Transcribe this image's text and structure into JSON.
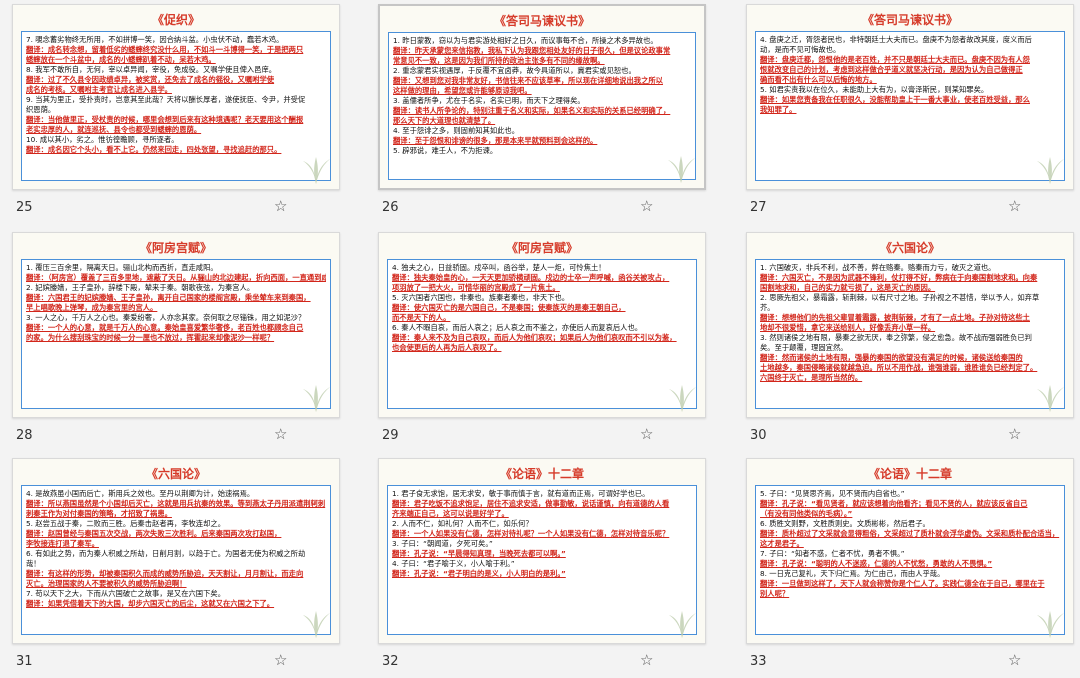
{
  "slides": [
    {
      "number": "25",
      "title": "《促织》",
      "lines": [
        {
          "t": "7. 覗念蓄劣物终无所用，不如拼博一笑，因合纳斗盆。小虫伏不动，蠢若木鸡。",
          "trans": false
        },
        {
          "t": "翻译：成名转念想，留着低劣的蟋蟀终究没什么用，不如斗一斗博得一笑，于是把两只",
          "trans": true
        },
        {
          "t": "蟋蟀放在一个斗盆中，成名的小蟋蟀趴着不动，呆若木鸡。",
          "trans": true
        },
        {
          "t": "8. 我军不敢所自，无何，宰以卓异闻，宰役，免成役。又嘱学使且俾入邑庠。",
          "trans": false
        },
        {
          "t": "翻译：过了不久县令因政绩卓异，被奖赏，还免去了成名的徭役，又嘱咐学使",
          "trans": true
        },
        {
          "t": "成名的考核。又嘱咐主考官让成名进入县学。",
          "trans": true
        },
        {
          "t": "9. 当其为里正，受扑责时，岂意其至此哉？天将以酬长厚者，遂使抚臣、令尹，并受促",
          "trans": false
        },
        {
          "t": "织恩荫。",
          "trans": false
        },
        {
          "t": "翻译：当他做里正，受杖责的时候，哪里会想到后来有这种境遇呢？老天要用这个酬报",
          "trans": true
        },
        {
          "t": "老实忠厚的人，就连巡抚、县令也都受到蟋蟀的恩荫。",
          "trans": true
        },
        {
          "t": "10. 成以其小，劣之。惟彷徨瞻顾，寻所逐者。",
          "trans": false
        },
        {
          "t": "翻译：成名因它个头小，看不上它。仍然来回走，四处张望，寻找追赶的那只。",
          "trans": true
        }
      ]
    },
    {
      "number": "26",
      "title": "《答司马谏议书》",
      "lines": [
        {
          "t": "1. 昨日蒙教，窃以为与君实游处相好之日久，而议事每不合，所操之术多异故也。",
          "trans": false
        },
        {
          "t": "翻译：昨天承蒙您来信指教，我私下认为我跟您相处友好的日子很久，但是议论政事常",
          "trans": true
        },
        {
          "t": "常意见不一致，这是因为我们所持的政治主张多有不同的缘故啊。",
          "trans": true
        },
        {
          "t": "2. 重念蒙君实视遇厚，于反覆不宜卤莽，故今具道所以，冀君实或见恕也。",
          "trans": false
        },
        {
          "t": "翻译：又想到您对我非常友好，书信往来不应该草率，所以现在详细地说出我之所以",
          "trans": true
        },
        {
          "t": "这样做的理由，希望您或许能够原谅我吧。",
          "trans": true
        },
        {
          "t": "3. 盖儒者所争，尤在于名实，名实已明，而天下之理得矣。",
          "trans": false
        },
        {
          "t": "翻译：读书人所争论的，特别注重于名义和实际，如果名义和实际的关系已经明确了，",
          "trans": true
        },
        {
          "t": "那么天下的大道理也就清楚了。",
          "trans": true
        },
        {
          "t": "4. 至于怨诽之多，则固前知其如此也。",
          "trans": false
        },
        {
          "t": "翻译：至于怨恨和诽谤的很多，那是本来早就预料到会这样的。",
          "trans": true
        },
        {
          "t": "5. 辟邪说，难壬人，不为拒谏。",
          "trans": false
        }
      ]
    },
    {
      "number": "27",
      "title": "《答司马谏议书》",
      "lines": [
        {
          "t": "4. 盘庚之迁，胥怨者民也，非特朝廷士大夫而已。盘庚不为怨者故改其度，度义而后",
          "trans": false
        },
        {
          "t": "动，是而不见可悔故也。",
          "trans": false
        },
        {
          "t": "翻译：盘庚迁都，怨恨他的是老百姓，并不只是朝廷士大夫而已。盘庚不因为有人怨",
          "trans": true
        },
        {
          "t": "恨就改变自己的计划，考虑到这样做合乎道义就坚决行动，是因为认为自己做得正",
          "trans": true
        },
        {
          "t": "确而看不出有什么可以后悔的地方。",
          "trans": true
        },
        {
          "t": "5. 如君实责我以在位久，未能助上大有为，以膏泽斯民，则某知罪矣。",
          "trans": false
        },
        {
          "t": "翻译：如果您责备我在任职很久，没能帮助皇上干一番大事业，使老百姓受益，那么",
          "trans": true
        },
        {
          "t": "我知罪了。",
          "trans": true
        }
      ]
    },
    {
      "number": "28",
      "title": "《阿房宫赋》",
      "lines": [
        {
          "t": "1. 覆压三百余里，隔离天日。骊山北构而西折，直走咸阳。",
          "trans": false
        },
        {
          "t": "翻译：（阿房宫）覆盖了三百多里地，遮蔽了天日。从骊山的北边建起，折向西面，一直通到咸阳。",
          "trans": true
        },
        {
          "t": "2. 妃嫔媵嫱，王子皇孙，辞楼下殿，辇来于秦。朝歌夜弦，为秦宫人。",
          "trans": false
        },
        {
          "t": "翻译：六国君王的妃嫔媵嫱、王子皇孙，离开自己国家的楼阁宫殿，乘坐辇车来到秦国，",
          "trans": true
        },
        {
          "t": "早上唱歌晚上弹琴，成为秦宫里的宫人。",
          "trans": true
        },
        {
          "t": "3. 一人之心，千万人之心也。秦爱纷奢，人亦念其家。奈何取之尽锱铢，用之如泥沙？",
          "trans": false
        },
        {
          "t": "翻译：一个人的心意，就是千万人的心意。秦始皇喜爱繁华奢侈，老百姓也都顾念自己",
          "trans": true
        },
        {
          "t": "的家。为什么搜刮珠宝的时候一分一厘也不放过，挥霍起来却像泥沙一样呢？",
          "trans": true
        }
      ]
    },
    {
      "number": "29",
      "title": "《阿房宫赋》",
      "lines": [
        {
          "t": "4. 独夫之心，日益骄固。戍卒叫，函谷举，楚人一炬，可怜焦土！",
          "trans": false
        },
        {
          "t": "翻译：独夫秦始皇的心，一天天更加骄横顽固。戍边的士卒一声呼喊，函谷关被攻占，",
          "trans": true
        },
        {
          "t": "项羽放了一把大火，可惜华丽的宫殿成了一片焦土。",
          "trans": true
        },
        {
          "t": "5. 灭六国者六国也，非秦也。族秦者秦也，非天下也。",
          "trans": false
        },
        {
          "t": "翻译：使六国灭亡的是六国自己，不是秦国；使秦族灭的是秦王朝自己，",
          "trans": true
        },
        {
          "t": "而不是天下的人。",
          "trans": true
        },
        {
          "t": "6. 秦人不暇自哀，而后人哀之；后人哀之而不鉴之，亦使后人而复哀后人也。",
          "trans": false
        },
        {
          "t": "翻译：秦人来不及为自己哀叹，而后人为他们哀叹；如果后人为他们哀叹而不引以为鉴，",
          "trans": true
        },
        {
          "t": "也会使更后的人再为后人哀叹了。",
          "trans": true
        }
      ]
    },
    {
      "number": "30",
      "title": "《六国论》",
      "lines": [
        {
          "t": "1. 六国破灭，非兵不利，战不善，弊在赂秦。赂秦而力亏，破灭之道也。",
          "trans": false
        },
        {
          "t": "翻译：六国灭亡，不是因为武器不锋利，仗打得不好，弊病在于向秦国割地求和。向秦",
          "trans": true
        },
        {
          "t": "国割地求和，自己的实力就亏损了，这是灭亡的原因。",
          "trans": true
        },
        {
          "t": "2. 思厥先祖父，暴霜露，斩荆棘，以有尺寸之地。子孙视之不甚惜，举以予人，如弃草",
          "trans": false
        },
        {
          "t": "芥。",
          "trans": false
        },
        {
          "t": "翻译：想想他们的先祖父辈冒着霜露，披荆斩棘，才有了一点土地。子孙对待这些土",
          "trans": true
        },
        {
          "t": "地却不很爱惜，拿它来送给别人，好像丢弃小草一样。",
          "trans": true
        },
        {
          "t": "3. 然则诸侯之地有限，暴秦之欲无厌，奉之弥繁，侵之愈急。故不战而强弱胜负已判",
          "trans": false
        },
        {
          "t": "矣。至于颠覆，理固宜然。",
          "trans": false
        },
        {
          "t": "翻译：然而诸侯的土地有限，强暴的秦国的欲望没有满足的时候，诸侯送给秦国的",
          "trans": true
        },
        {
          "t": "土地越多，秦国侵略诸侯就越急迫。所以不用作战，谁强谁弱，谁胜谁负已经判定了。",
          "trans": true
        },
        {
          "t": "六国终于灭亡，是理所当然的。",
          "trans": true
        }
      ]
    },
    {
      "number": "31",
      "title": "《六国论》",
      "lines": [
        {
          "t": "4. 是故燕虽小国而后亡，斯用兵之效也。至丹以荆卿为计，始速祸焉。",
          "trans": false
        },
        {
          "t": "翻译：所以燕国虽然是个小国却后灭亡，这就是用兵抗秦的效果。等到燕太子丹用派遣荆轲刺",
          "trans": true
        },
        {
          "t": "刺秦王作为对付秦国的策略，才招致了祸患。",
          "trans": true
        },
        {
          "t": "5. 赵尝五战于秦，二败而三胜。后秦击赵者再，李牧连却之。",
          "trans": false
        },
        {
          "t": "翻译：赵国曾经与秦国五次交战，两次失败三次胜利。后来秦国两次攻打赵国，",
          "trans": true
        },
        {
          "t": "李牧接连打退了秦军。",
          "trans": true
        },
        {
          "t": "6. 有如此之势，而为秦人积威之所劫，日削月割，以趋于亡。为国者无使为积威之所劫",
          "trans": false
        },
        {
          "t": "哉！",
          "trans": false
        },
        {
          "t": "翻译：有这样的形势，却被秦国积久而成的威势所胁迫，天天割让，月月割让，而走向",
          "trans": true
        },
        {
          "t": "灭亡。治理国家的人不要被积久的威势所胁迫啊！",
          "trans": true
        },
        {
          "t": "7. 苟以天下之大，下而从六国破亡之故事，是又在六国下矣。",
          "trans": false
        },
        {
          "t": "翻译：如果凭借着天下的大国，却步六国灭亡的后尘，这就又在六国之下了。",
          "trans": true
        }
      ]
    },
    {
      "number": "32",
      "title": "《论语》十二章",
      "lines": [
        {
          "t": "1. 君子食无求饱，居无求安，敏于事而慎于言，就有道而正焉，可谓好学也已。",
          "trans": false
        },
        {
          "t": "翻译：君子吃饭不追求饱足，居住不追求安适，做事勤敏，说话谨慎，向有道德的人看",
          "trans": true
        },
        {
          "t": "齐来端正自己，这可以说是好学了。",
          "trans": true
        },
        {
          "t": "2. 人而不仁，如礼何？人而不仁，如乐何？",
          "trans": false
        },
        {
          "t": "翻译：一个人如果没有仁德，怎样对待礼呢？一个人如果没有仁德，怎样对待音乐呢？",
          "trans": true
        },
        {
          "t": "3. 子曰：“朝闻道，夕死可矣。”",
          "trans": false
        },
        {
          "t": "翻译：孔子说：“早晨得知真理，当晚死去都可以啊。”",
          "trans": true
        },
        {
          "t": "4. 子曰：“君子喻于义，小人喻于利。”",
          "trans": false
        },
        {
          "t": "翻译：孔子说：“君子明白的是义，小人明白的是利。”",
          "trans": true
        }
      ]
    },
    {
      "number": "33",
      "title": "《论语》十二章",
      "lines": [
        {
          "t": "5. 子曰：“见贤思齐焉，见不贤而内自省也。”",
          "trans": false
        },
        {
          "t": "翻译：孔子说：“看见贤者，就应该想着向他看齐；看见不贤的人，就应该反省自己",
          "trans": true
        },
        {
          "t": "（有没有同他类似的毛病）。”",
          "trans": true
        },
        {
          "t": "6. 质胜文则野，文胜质则史。文质彬彬，然后君子。",
          "trans": false
        },
        {
          "t": "翻译：质朴超过了文采就会显得粗俗，文采超过了质朴就会浮华虚伪。文采和质朴配合适当，",
          "trans": true
        },
        {
          "t": "这才是君子。",
          "trans": true
        },
        {
          "t": "7. 子曰：“知者不惑，仁者不忧，勇者不惧。”",
          "trans": false
        },
        {
          "t": "翻译：孔子说：“聪明的人不迷惑，仁德的人不忧愁，勇敢的人不畏惧。”",
          "trans": true
        },
        {
          "t": "8. 一日克己复礼，天下归仁焉。为仁由己，而由人乎哉。",
          "trans": false
        },
        {
          "t": "翻译：一旦做到这样了，天下人就会称赞你是个仁人了。实践仁德全在于自己，哪里在于",
          "trans": true
        },
        {
          "t": "别人呢？",
          "trans": true
        }
      ]
    }
  ]
}
